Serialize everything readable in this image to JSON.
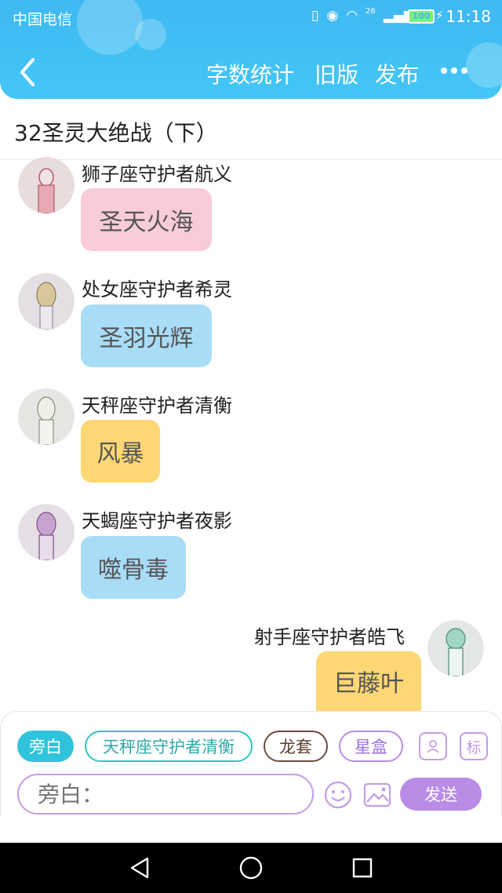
{
  "status_bar": {
    "carrier": "中国电信",
    "network": "26",
    "battery": "100",
    "time": "11:18"
  },
  "nav": {
    "back_icon": "chevron-left-icon",
    "actions": [
      "字数统计",
      "旧版",
      "发布"
    ],
    "more_icon": "more-dots-icon"
  },
  "title": "32圣灵大绝战（下）",
  "messages": [
    {
      "sender": "狮子座守护者航义",
      "text": "圣天火海",
      "side": "left",
      "bubble_color": "#f9cdd8"
    },
    {
      "sender": "处女座守护者希灵",
      "text": "圣羽光辉",
      "side": "left",
      "bubble_color": "#a9dcf7"
    },
    {
      "sender": "天秤座守护者清衡",
      "text": "风暴",
      "side": "left",
      "bubble_color": "#fcd774"
    },
    {
      "sender": "天蝎座守护者夜影",
      "text": "噬骨毒",
      "side": "left",
      "bubble_color": "#a9dcf7"
    },
    {
      "sender": "射手座守护者皓飞",
      "text": "巨藤叶",
      "side": "right",
      "bubble_color": "#fcd774"
    }
  ],
  "composer": {
    "roles": [
      {
        "label": "旁白",
        "selected": true
      },
      {
        "label": "天秤座守护者清衡",
        "selected": false
      },
      {
        "label": "龙套",
        "selected": false
      },
      {
        "label": "星盒",
        "selected": false
      }
    ],
    "role_icon": "person-card-icon",
    "tag_button": "标",
    "input_placeholder": "旁白：",
    "emoji_icon": "smiley-icon",
    "image_icon": "image-icon",
    "send_label": "发送"
  },
  "colors": {
    "header": "#3fb9f2",
    "accent_purple": "#b98ce6",
    "accent_teal": "#2fc4c4"
  },
  "system_nav": [
    "back-triangle-icon",
    "home-circle-icon",
    "recents-square-icon"
  ]
}
